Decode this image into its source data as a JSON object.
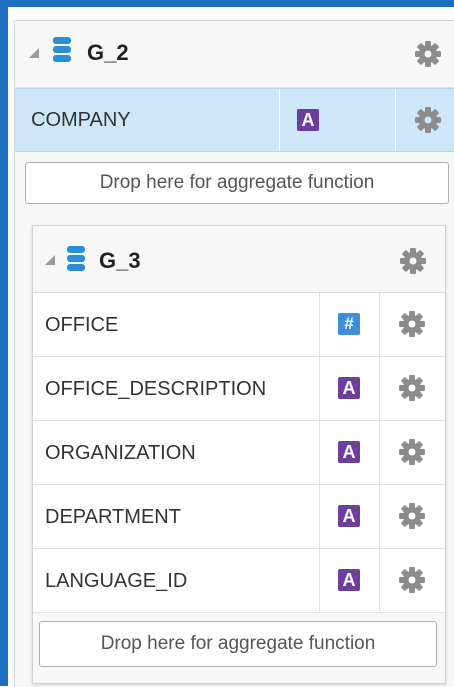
{
  "group_outer": {
    "title": "G_2",
    "field": {
      "name": "COMPANY",
      "type_badge": "A",
      "type": "alphanumeric"
    },
    "drop_zone": "Drop here for aggregate function"
  },
  "group_inner": {
    "title": "G_3",
    "fields": [
      {
        "name": "OFFICE",
        "type_badge": "#",
        "type": "numeric"
      },
      {
        "name": "OFFICE_DESCRIPTION",
        "type_badge": "A",
        "type": "alphanumeric"
      },
      {
        "name": "ORGANIZATION",
        "type_badge": "A",
        "type": "alphanumeric"
      },
      {
        "name": "DEPARTMENT",
        "type_badge": "A",
        "type": "alphanumeric"
      },
      {
        "name": "LANGUAGE_ID",
        "type_badge": "A",
        "type": "alphanumeric"
      }
    ],
    "drop_zone": "Drop here for aggregate function"
  },
  "icons": {
    "collapse": "collapse-triangle-icon",
    "data_group": "database-icon",
    "settings": "gear-icon"
  },
  "colors": {
    "accent_border": "#1e6fbf",
    "selected_row": "#cde7f8",
    "alpha_badge": "#6a3fa0",
    "numeric_badge": "#3f8fd8",
    "gear": "#8c8c8c"
  }
}
